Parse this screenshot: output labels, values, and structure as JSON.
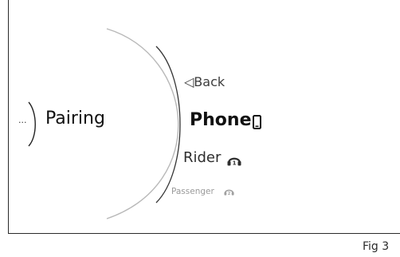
{
  "menu": {
    "more_label": "...",
    "current_label": "Pairing",
    "items": [
      {
        "label": "◁Back"
      },
      {
        "label": "Phone"
      },
      {
        "label": "Rider"
      },
      {
        "label": "Passenger"
      }
    ]
  },
  "icons": {
    "phone": "phone-icon",
    "rider": "rider-headset-icon",
    "passenger": "passenger-headset-icon"
  },
  "caption": "Fig 3"
}
